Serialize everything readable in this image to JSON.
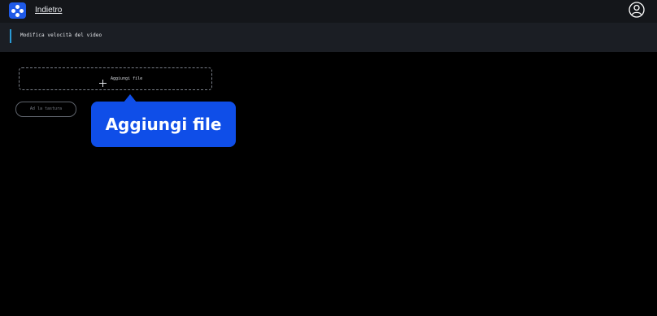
{
  "header": {
    "back_label": "Indietro",
    "logo_icon": "app-logo-icon",
    "user_icon": "user-avatar-icon"
  },
  "subheader": {
    "title": "Modifica velocità del video"
  },
  "upload": {
    "add_file_label": "Aggiungi file",
    "plus_icon": "plus-icon"
  },
  "secondary_button": {
    "label": "Ad la tastura"
  },
  "tooltip": {
    "text": "Aggiungi file"
  },
  "colors": {
    "background": "#000000",
    "topbar": "#14161a",
    "subbar": "#1b1e24",
    "accent": "#2a9bd6",
    "tooltip": "#0f4ee8",
    "logo": "#1f5ae8"
  }
}
